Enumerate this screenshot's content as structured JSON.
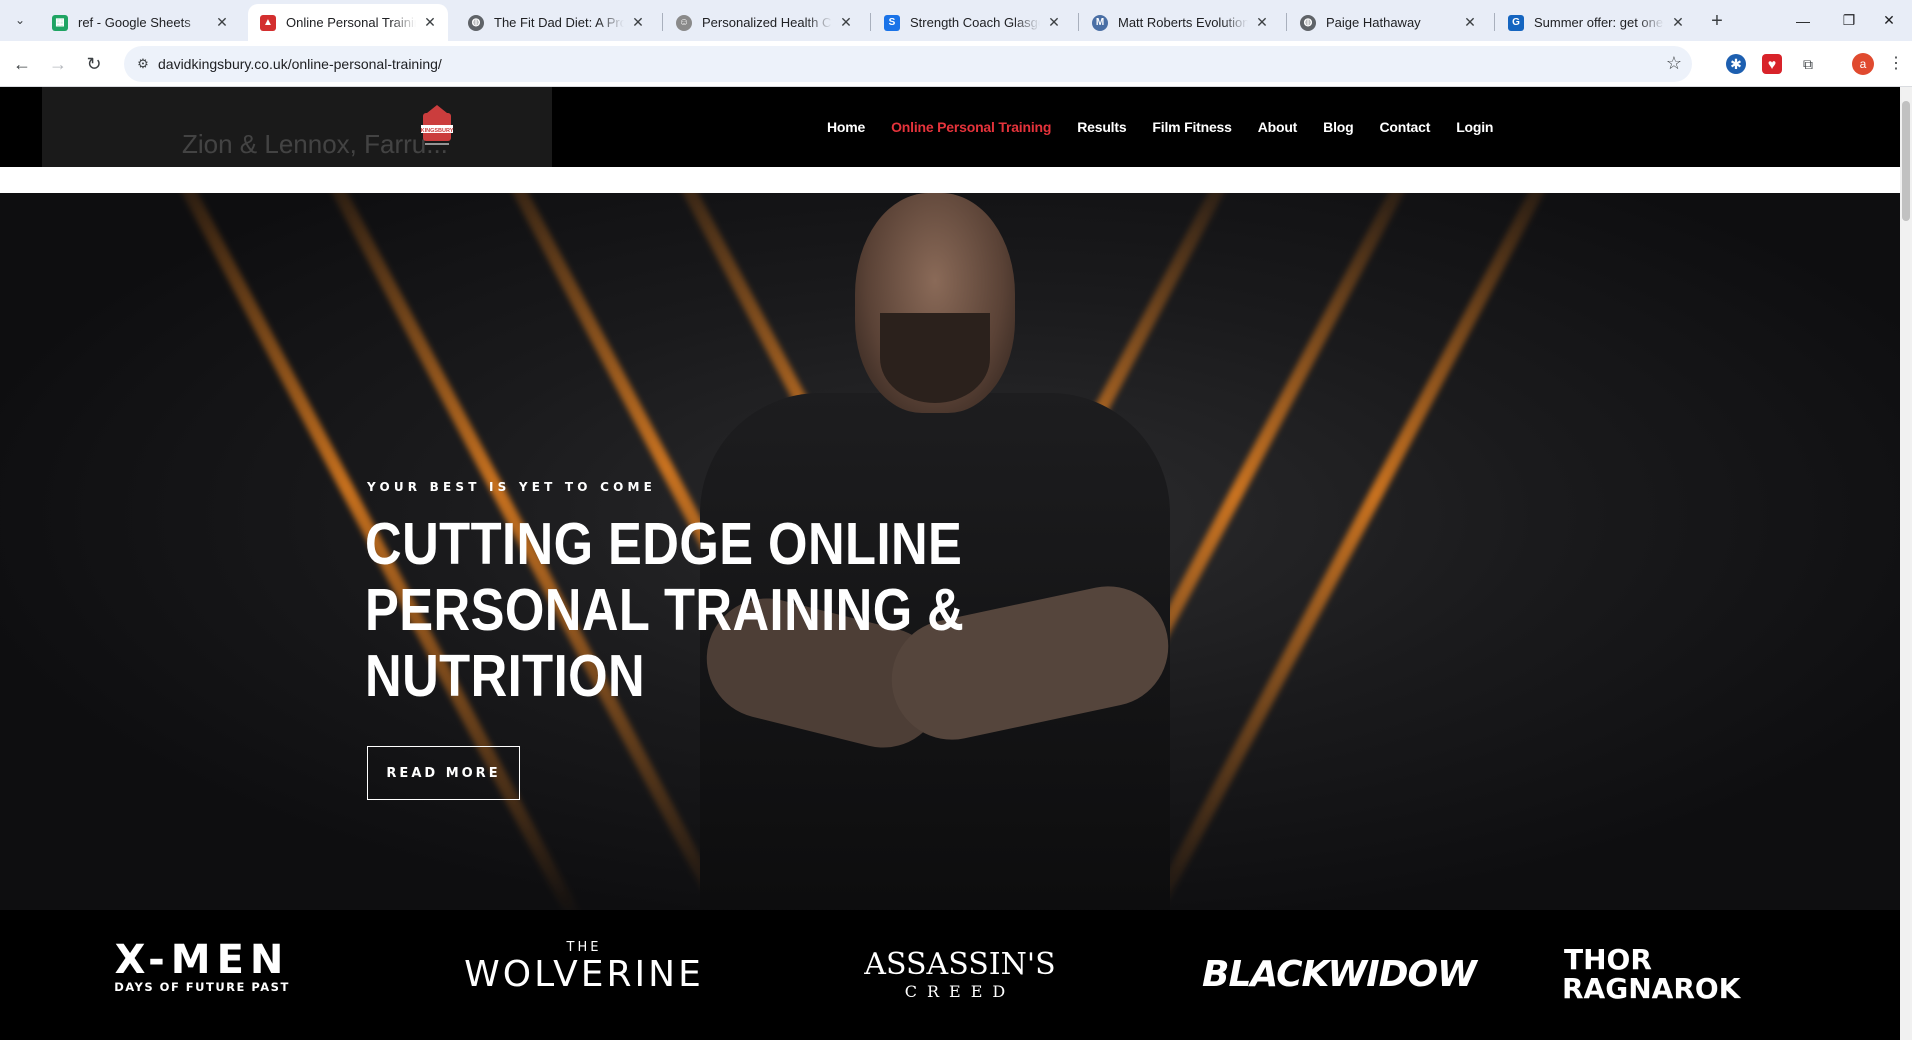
{
  "browser": {
    "tabs": [
      {
        "title": "ref - Google Sheets",
        "favicon": "sheets-icon",
        "color": "#1fa463"
      },
      {
        "title": "Online Personal Training | ",
        "favicon": "kingsbury-icon",
        "color": "#d32f2f",
        "active": true
      },
      {
        "title": "The Fit Dad Diet: A Proven",
        "favicon": "globe-icon",
        "color": "#5f6368"
      },
      {
        "title": "Personalized Health Coach",
        "favicon": "coach-icon",
        "color": "#7a7a7a"
      },
      {
        "title": "Strength Coach Glasgow",
        "favicon": "s-icon",
        "color": "#1a73e8"
      },
      {
        "title": "Matt Roberts Evolution | ",
        "favicon": "mr-icon",
        "color": "#4a6fa5"
      },
      {
        "title": "Paige Hathaway",
        "favicon": "globe-icon",
        "color": "#5f6368"
      },
      {
        "title": "Summer offer: get one m",
        "favicon": "offer-icon",
        "color": "#1565c0"
      }
    ],
    "url": "davidkingsbury.co.uk/online-personal-training/",
    "profile_initial": "a"
  },
  "site": {
    "nav": [
      "Home",
      "Online Personal Training",
      "Results",
      "Film Fitness",
      "About",
      "Blog",
      "Contact",
      "Login"
    ],
    "current_nav": "Online Personal Training",
    "ghost_text": "Zion & Lennox, Farru...",
    "logo_text": "KINGSBURY"
  },
  "hero": {
    "kicker": "YOUR BEST IS YET TO COME",
    "title_lines": [
      "CUTTING EDGE ONLINE",
      "PERSONAL TRAINING &",
      "NUTRITION"
    ],
    "button": "READ MORE"
  },
  "brands": {
    "xmen_main": "X-MEN",
    "xmen_sub": "DAYS OF FUTURE PAST",
    "wolverine_top": "THE",
    "wolverine_main": "WOLVERINE",
    "assassins_main": "ASSASSIN'S",
    "assassins_sub": "CREED",
    "blackwidow": "BLACKWIDOW",
    "thor_top": "THOR",
    "thor_main": "RAGNAROK"
  }
}
